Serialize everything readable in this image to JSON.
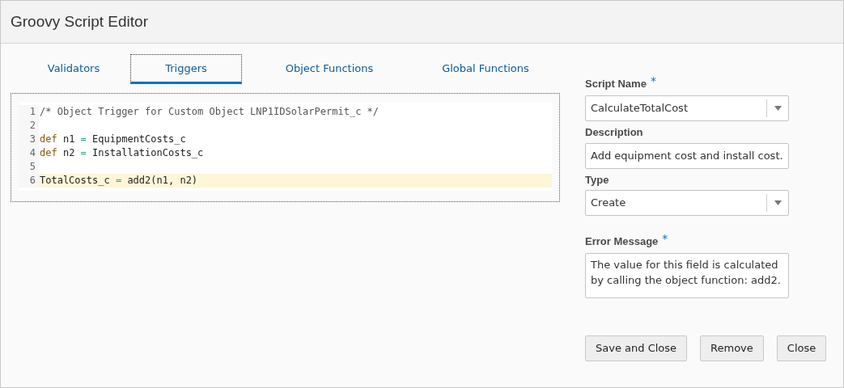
{
  "window": {
    "title": "Groovy Script Editor"
  },
  "tabs": [
    {
      "label": "Validators",
      "selected": false
    },
    {
      "label": "Triggers",
      "selected": true
    },
    {
      "label": "Object Functions",
      "selected": false
    },
    {
      "label": "Global Functions",
      "selected": false
    }
  ],
  "editor": {
    "lines": [
      {
        "number": "1",
        "highlighted": false,
        "tokens": [
          {
            "kind": "comment",
            "text": "/* Object Trigger for Custom Object LNP1IDSolarPermit_c */"
          }
        ]
      },
      {
        "number": "2",
        "highlighted": false
      },
      {
        "number": "3",
        "highlighted": false,
        "tokens": [
          {
            "kind": "keyword",
            "text": "def"
          },
          {
            "kind": "plain",
            "text": " n1 "
          },
          {
            "kind": "operator",
            "text": "="
          },
          {
            "kind": "plain",
            "text": " EquipmentCosts_c"
          }
        ]
      },
      {
        "number": "4",
        "highlighted": false,
        "tokens": [
          {
            "kind": "keyword",
            "text": "def"
          },
          {
            "kind": "plain",
            "text": " n2 "
          },
          {
            "kind": "operator",
            "text": "="
          },
          {
            "kind": "plain",
            "text": " InstallationCosts_c"
          }
        ]
      },
      {
        "number": "5",
        "highlighted": false
      },
      {
        "number": "6",
        "highlighted": true,
        "tokens": [
          {
            "kind": "plain",
            "text": "TotalCosts_c "
          },
          {
            "kind": "operator",
            "text": "="
          },
          {
            "kind": "plain",
            "text": " add2(n1, n2)"
          }
        ]
      }
    ]
  },
  "form": {
    "fields": [
      {
        "kind": "select",
        "label": "Script Name",
        "required_mark": "*",
        "value": "CalculateTotalCost"
      },
      {
        "kind": "text",
        "label": "Description",
        "value": "Add equipment cost and install cost."
      },
      {
        "kind": "select",
        "label": "Type",
        "value": "Create"
      },
      {
        "kind": "textarea",
        "label": "Error Message",
        "required_mark": "*",
        "value": "The value for this field is calculated by calling the object function: add2."
      }
    ]
  },
  "buttons": [
    "Save and Close",
    "Remove",
    "Close"
  ]
}
